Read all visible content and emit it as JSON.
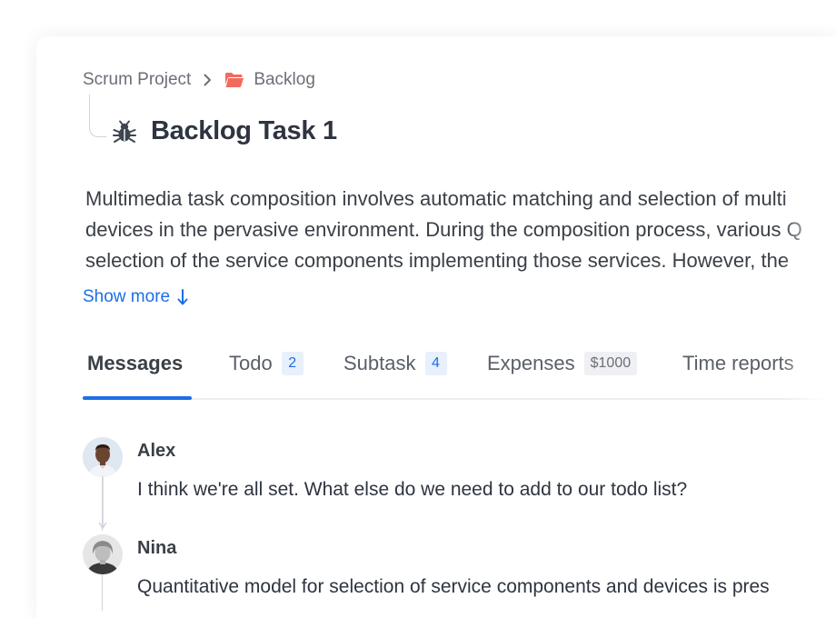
{
  "breadcrumb": {
    "project": "Scrum Project",
    "folder": "Backlog"
  },
  "task": {
    "title": "Backlog Task 1",
    "icon": "bug-icon"
  },
  "description": {
    "lines": [
      "Multimedia task composition involves automatic matching and selection of multi",
      "devices in the pervasive environment. During the composition process, various Q",
      "selection of the service components implementing those services. However, the"
    ],
    "show_more": "Show more"
  },
  "tabs": [
    {
      "label": "Messages",
      "active": true
    },
    {
      "label": "Todo",
      "badge": "2"
    },
    {
      "label": "Subtask",
      "badge": "4"
    },
    {
      "label": "Expenses",
      "badge": "$1000"
    },
    {
      "label": "Time reports"
    }
  ],
  "messages": [
    {
      "author": "Alex",
      "text": "I think we're all set. What else do we need to add to our todo list?"
    },
    {
      "author": "Nina",
      "text": "Quantitative model for selection of service components and devices is pres"
    }
  ],
  "colors": {
    "accent": "#1b6fe6",
    "folder": "#f26a5e",
    "title": "#2e3440"
  }
}
